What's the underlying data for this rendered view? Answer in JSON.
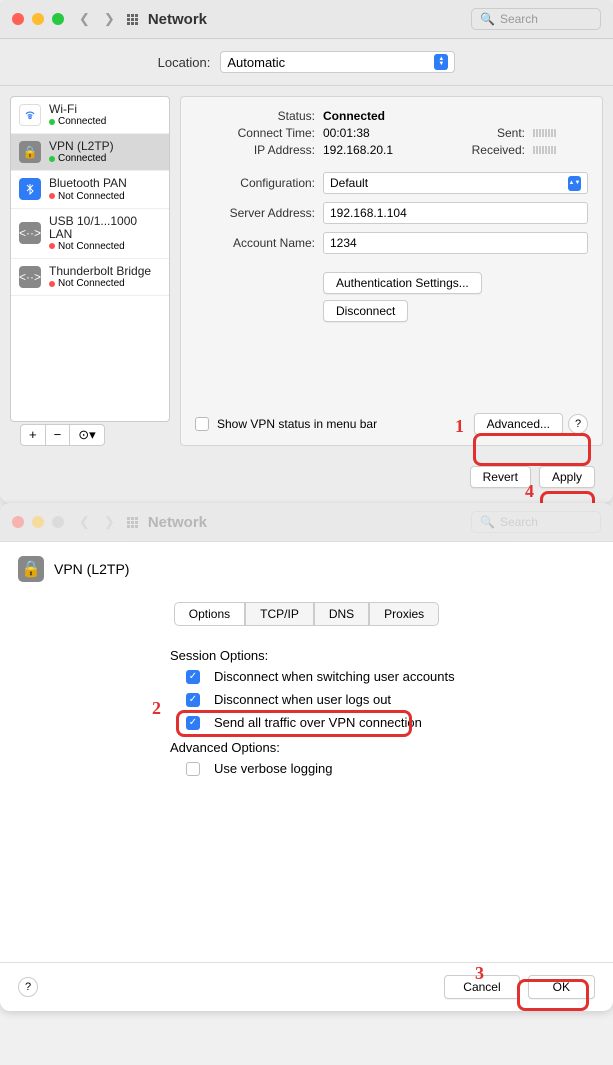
{
  "window1": {
    "title": "Network",
    "search_placeholder": "Search",
    "location_label": "Location:",
    "location_value": "Automatic",
    "sidebar": [
      {
        "name": "Wi-Fi",
        "status": "Connected",
        "connected": true,
        "icon": "wifi"
      },
      {
        "name": "VPN (L2TP)",
        "status": "Connected",
        "connected": true,
        "icon": "lock",
        "selected": true
      },
      {
        "name": "Bluetooth PAN",
        "status": "Not Connected",
        "connected": false,
        "icon": "bt"
      },
      {
        "name": "USB 10/1...1000 LAN",
        "status": "Not Connected",
        "connected": false,
        "icon": "usb"
      },
      {
        "name": "Thunderbolt Bridge",
        "status": "Not Connected",
        "connected": false,
        "icon": "usb"
      }
    ],
    "status": {
      "status_label": "Status:",
      "status_value": "Connected",
      "connect_time_label": "Connect Time:",
      "connect_time_value": "00:01:38",
      "ip_label": "IP Address:",
      "ip_value": "192.168.20.1",
      "sent_label": "Sent:",
      "received_label": "Received:"
    },
    "form": {
      "config_label": "Configuration:",
      "config_value": "Default",
      "server_label": "Server Address:",
      "server_value": "192.168.1.104",
      "account_label": "Account Name:",
      "account_value": "1234"
    },
    "auth_settings_btn": "Authentication Settings...",
    "disconnect_btn": "Disconnect",
    "show_vpn_status": "Show VPN status in menu bar",
    "advanced_btn": "Advanced...",
    "revert_btn": "Revert",
    "apply_btn": "Apply",
    "annotations": {
      "num1": "1",
      "num4": "4"
    }
  },
  "window2": {
    "title": "Network",
    "search_placeholder": "Search",
    "vpn_title": "VPN (L2TP)",
    "tabs": [
      "Options",
      "TCP/IP",
      "DNS",
      "Proxies"
    ],
    "session_label": "Session Options:",
    "options": [
      {
        "label": "Disconnect when switching user accounts",
        "checked": true
      },
      {
        "label": "Disconnect when user logs out",
        "checked": true
      },
      {
        "label": "Send all traffic over VPN connection",
        "checked": true
      }
    ],
    "advanced_label": "Advanced Options:",
    "verbose_option": {
      "label": "Use verbose logging",
      "checked": false
    },
    "cancel_btn": "Cancel",
    "ok_btn": "OK",
    "annotations": {
      "num2": "2",
      "num3": "3"
    }
  }
}
